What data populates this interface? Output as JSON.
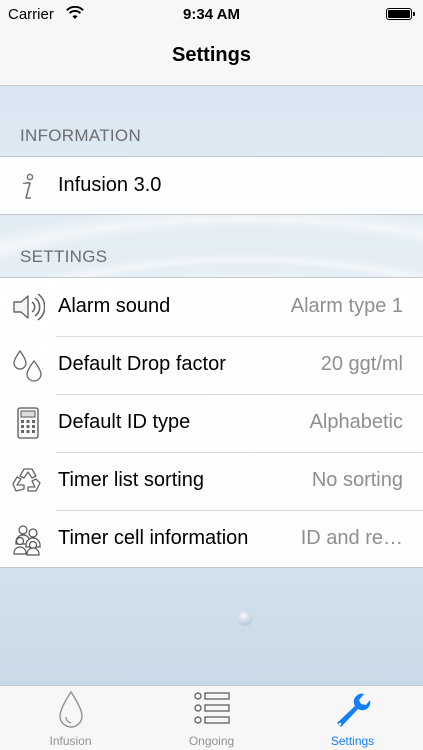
{
  "status_bar": {
    "carrier": "Carrier",
    "time": "9:34 AM"
  },
  "nav": {
    "title": "Settings"
  },
  "sections": {
    "information": {
      "header": "INFORMATION",
      "rows": [
        {
          "label": "Infusion 3.0",
          "icon": "info-icon"
        }
      ]
    },
    "settings": {
      "header": "SETTINGS",
      "rows": [
        {
          "label": "Alarm sound",
          "value": "Alarm type 1",
          "icon": "speaker-icon"
        },
        {
          "label": "Default Drop factor",
          "value": "20 ggt/ml",
          "icon": "drops-icon"
        },
        {
          "label": "Default ID type",
          "value": "Alphabetic",
          "icon": "calculator-icon"
        },
        {
          "label": "Timer list sorting",
          "value": "No sorting",
          "icon": "recycle-icon"
        },
        {
          "label": "Timer cell information",
          "value": "ID and re…",
          "icon": "people-icon"
        }
      ]
    }
  },
  "tabs": [
    {
      "label": "Infusion",
      "icon": "drop-icon",
      "active": false
    },
    {
      "label": "Ongoing",
      "icon": "list-icon",
      "active": false
    },
    {
      "label": "Settings",
      "icon": "wrench-icon",
      "active": true
    }
  ],
  "colors": {
    "accent": "#147efb",
    "secondary_text": "#8e8e93",
    "section_header": "#6d6d72"
  }
}
